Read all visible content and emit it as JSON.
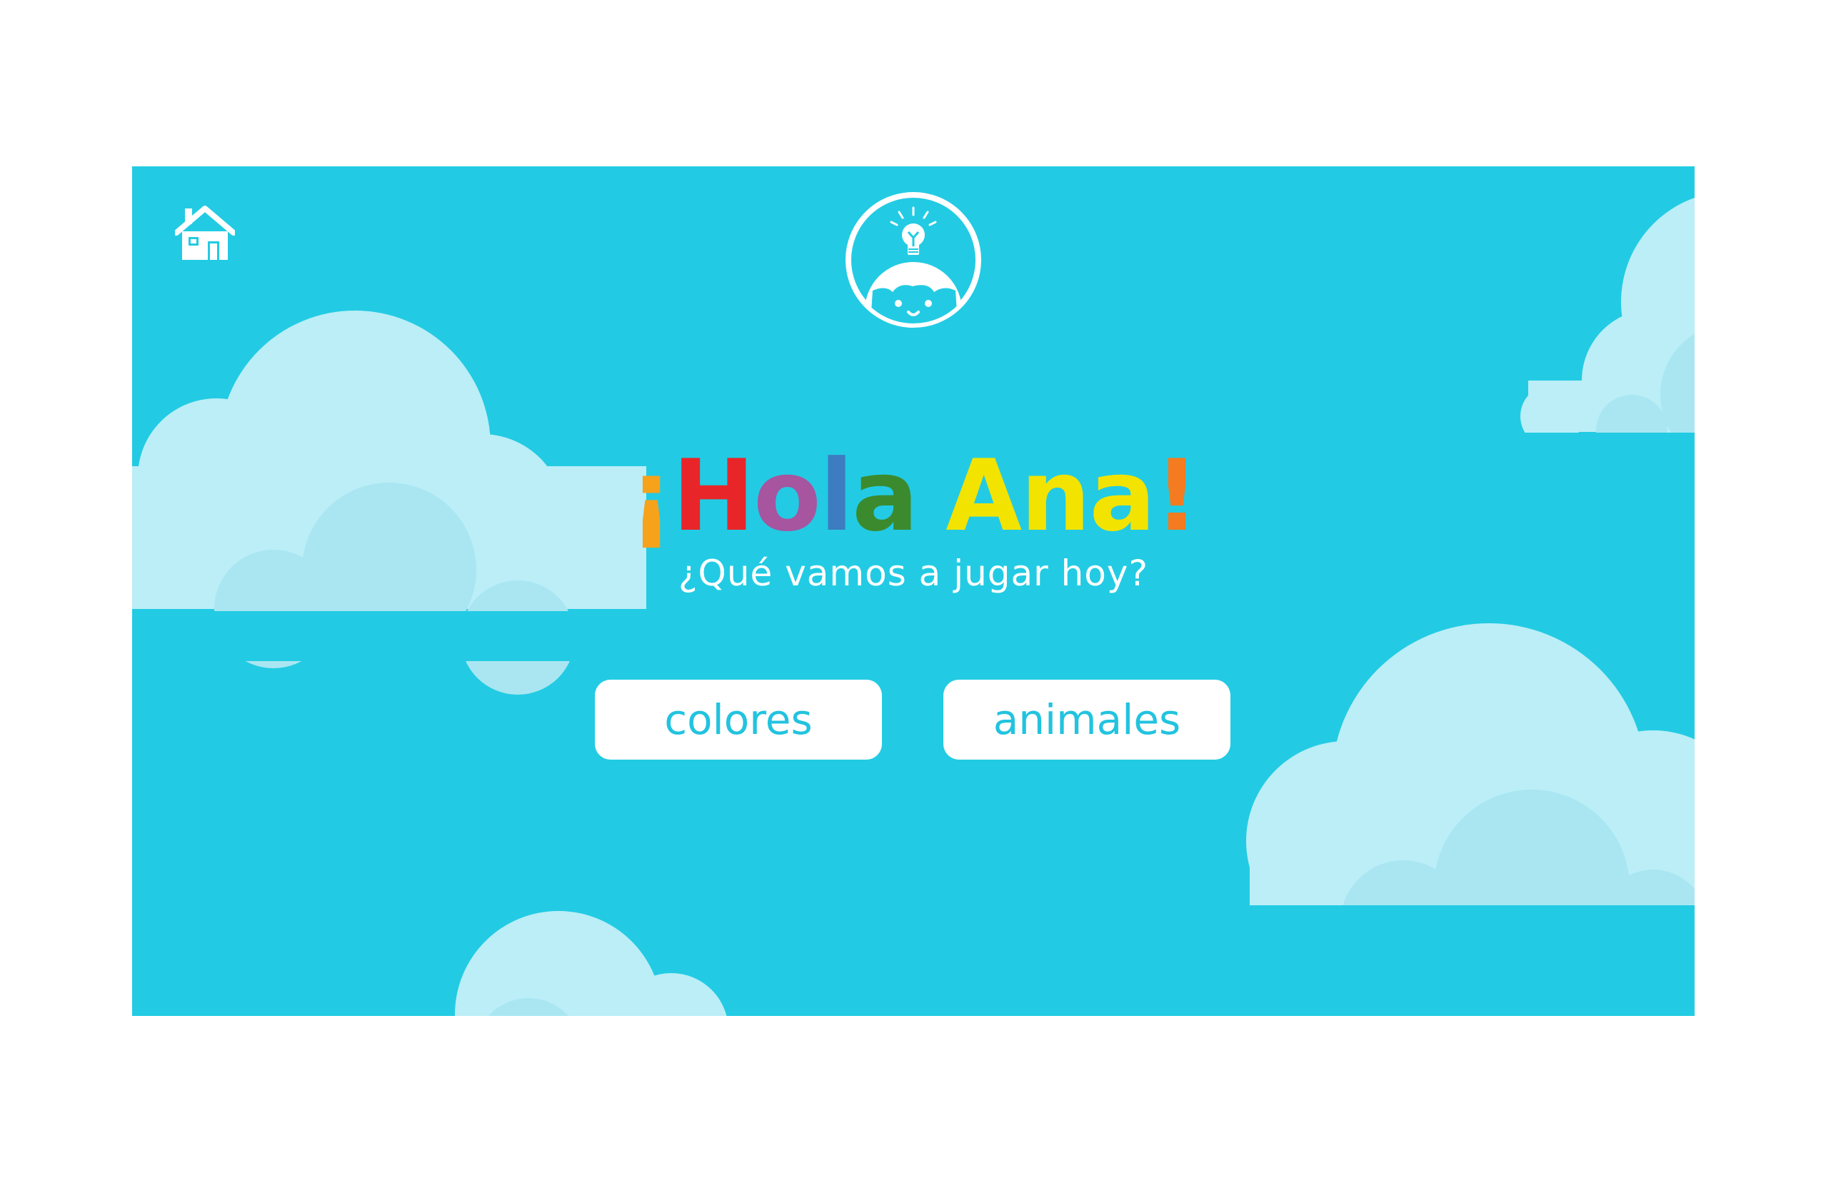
{
  "app": {
    "background_color": "#22cbe3",
    "cloud_color": "#bbeef7",
    "cloud_shadow_color": "#a9e6f2"
  },
  "header": {
    "home_icon": "home-icon",
    "avatar_icon": "lightbulb-kid-avatar-icon"
  },
  "greeting": {
    "letters": [
      {
        "char": "¡",
        "color": "#f7a21b"
      },
      {
        "char": "H",
        "color": "#e8262a"
      },
      {
        "char": "o",
        "color": "#a6559e"
      },
      {
        "char": "l",
        "color": "#3d7cc0"
      },
      {
        "char": "a",
        "color": "#3c8a2e"
      },
      {
        "char": " ",
        "color": "#ffffff"
      },
      {
        "char": "A",
        "color": "#f2e300"
      },
      {
        "char": "n",
        "color": "#f2e300"
      },
      {
        "char": "a",
        "color": "#f2e300"
      },
      {
        "char": "!",
        "color": "#f47b20"
      }
    ]
  },
  "subtitle": "¿Qué vamos a jugar hoy?",
  "buttons": {
    "colores_label": "colores",
    "animales_label": "animales"
  }
}
